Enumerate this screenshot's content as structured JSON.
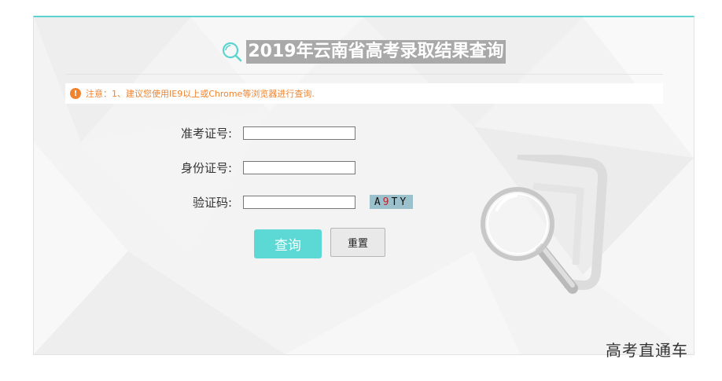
{
  "page": {
    "title": "2019年云南省高考录取结果查询",
    "notice": "注意：1、建议您使用IE9以上或Chrome等浏览器进行查询.",
    "accent_color": "#5cd4cf",
    "notice_color": "#f0832f"
  },
  "form": {
    "exam_id_label": "准考证号:",
    "exam_id_value": "",
    "id_card_label": "身份证号:",
    "id_card_value": "",
    "captcha_label": "验证码:",
    "captcha_value": "",
    "captcha_chars": [
      "A",
      "9",
      "T",
      "Y"
    ]
  },
  "buttons": {
    "query": "查询",
    "reset": "重置"
  },
  "icons": {
    "title": "search-icon",
    "notice": "warning-icon",
    "decoration": "magnifier-icon"
  },
  "watermark": "高考直通车"
}
